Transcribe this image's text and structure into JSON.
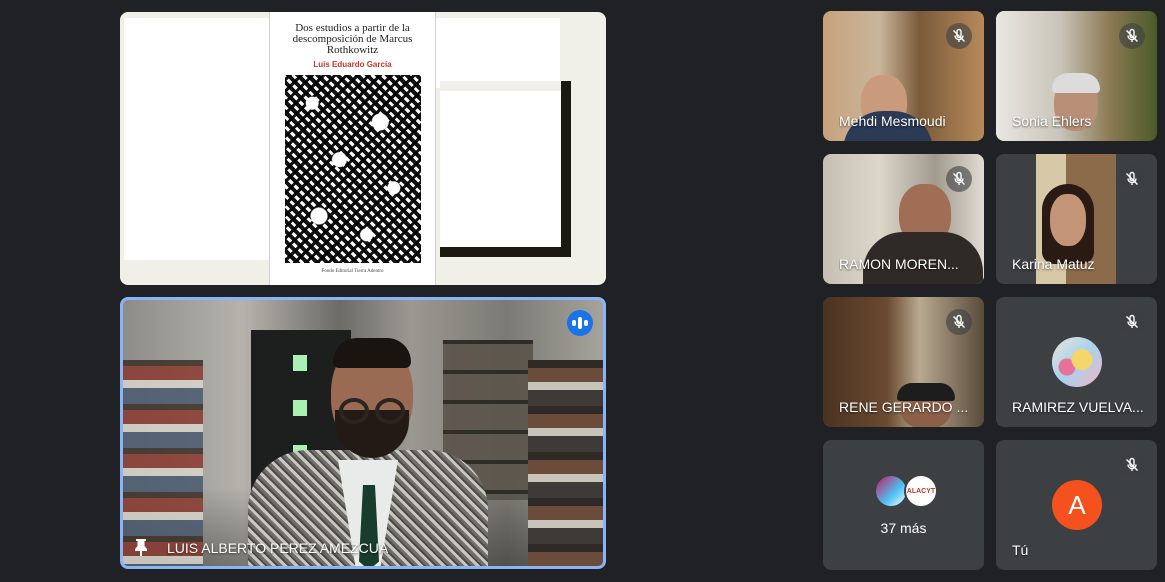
{
  "presentation": {
    "book": {
      "title": "Dos estudios a partir de la descomposición de Marcus Rothkowitz",
      "author": "Luis Eduardo García",
      "publisher": "Fondo Editorial Tierra Adentro"
    }
  },
  "speaker": {
    "name": "LUIS ALBERTO PEREZ AMEZCUA",
    "pinned": true,
    "speaking": true
  },
  "participants": [
    {
      "name": "Mehdi Mesmoudi",
      "muted": true
    },
    {
      "name": "Sonia Ehlers",
      "muted": true
    },
    {
      "name": "RAMON MOREN...",
      "muted": true
    },
    {
      "name": "Karina Matuz",
      "muted": true
    },
    {
      "name": "RENE GERARDO ...",
      "muted": true
    },
    {
      "name": "RAMIREZ VUELVA...",
      "muted": true
    },
    {
      "more_label": "37 más",
      "avatar_text": "ALACYT"
    },
    {
      "name": "Tú",
      "avatar_letter": "A",
      "muted": true
    }
  ],
  "colors": {
    "background": "#202124",
    "tile": "#3c4043",
    "active_border": "#8ab4f8",
    "speaking": "#1a73e8",
    "self_avatar": "#f4511e"
  }
}
